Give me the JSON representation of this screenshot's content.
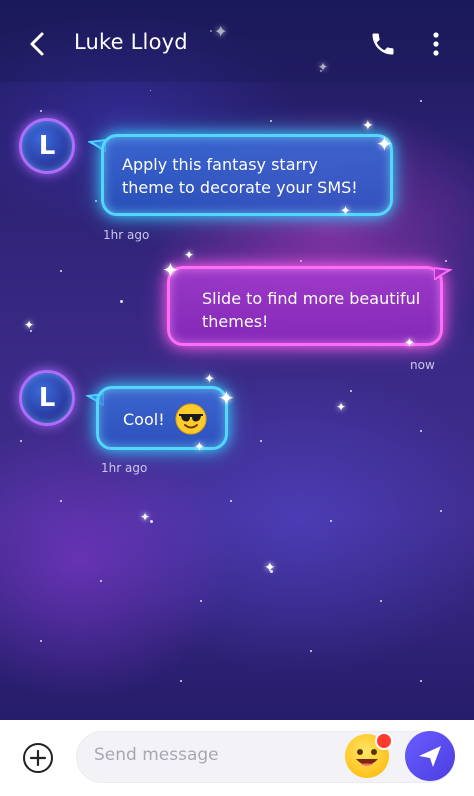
{
  "header": {
    "contact_name": "Luke Lloyd",
    "icons": [
      "back-arrow-icon",
      "phone-icon",
      "more-vert-icon"
    ]
  },
  "messages": [
    {
      "direction": "incoming",
      "avatar_letter": "L",
      "text": "Apply this fantasy starry theme to decorate your SMS!",
      "time": "1hr ago"
    },
    {
      "direction": "outgoing",
      "text": "Slide to find more beautiful themes!",
      "time": "now"
    },
    {
      "direction": "incoming",
      "avatar_letter": "L",
      "text": "Cool!",
      "emoji": "smiling-face-with-sunglasses",
      "time": "1hr ago"
    }
  ],
  "composer": {
    "placeholder": "Send message",
    "icons": [
      "add-circle-icon",
      "emoji-icon",
      "send-icon"
    ]
  },
  "colors": {
    "incoming_glow": "#52d8ff",
    "outgoing_glow": "#ff6cf5",
    "send_button": "#5a4cf0"
  }
}
